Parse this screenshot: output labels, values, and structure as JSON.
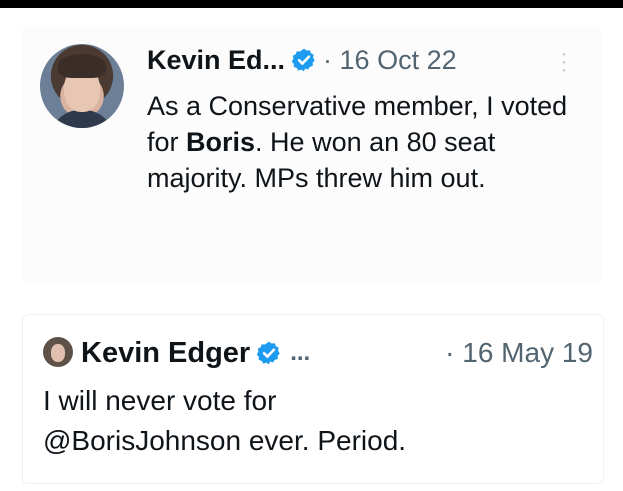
{
  "tweet_main": {
    "name": "Kevin Ed...",
    "date": "· 16 Oct 22",
    "text_part1": "As a Conservative member, I voted for ",
    "text_bold": "Boris",
    "text_part2": ". He won an 80 seat majority. MPs threw him out.",
    "avatar": "user-photo",
    "verified_icon": "verified-badge-icon",
    "more_icon": "more-options-icon"
  },
  "tweet_quoted": {
    "name": "Kevin Edger",
    "ellipsis": "...",
    "date": "· 16 May 19",
    "text_line1": "I will never vote for",
    "text_line2": "@BorisJohnson ever. Period.",
    "avatar": "user-photo",
    "verified_icon": "verified-badge-icon"
  },
  "colors": {
    "verified_blue": "#1d9bf0",
    "text_primary": "#0f1419",
    "text_secondary": "#536471"
  }
}
